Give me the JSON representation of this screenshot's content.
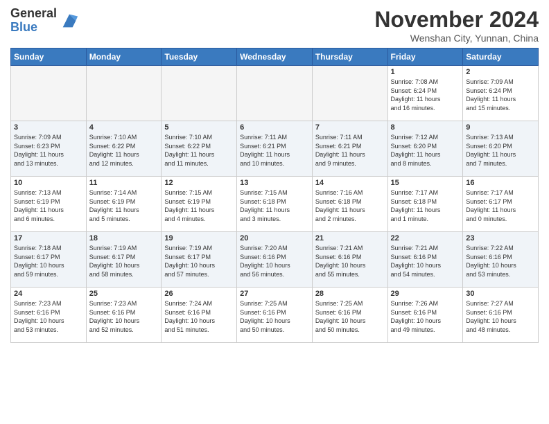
{
  "header": {
    "logo_general": "General",
    "logo_blue": "Blue",
    "month_title": "November 2024",
    "subtitle": "Wenshan City, Yunnan, China"
  },
  "days_of_week": [
    "Sunday",
    "Monday",
    "Tuesday",
    "Wednesday",
    "Thursday",
    "Friday",
    "Saturday"
  ],
  "weeks": [
    [
      {
        "day": "",
        "info": ""
      },
      {
        "day": "",
        "info": ""
      },
      {
        "day": "",
        "info": ""
      },
      {
        "day": "",
        "info": ""
      },
      {
        "day": "",
        "info": ""
      },
      {
        "day": "1",
        "info": "Sunrise: 7:08 AM\nSunset: 6:24 PM\nDaylight: 11 hours\nand 16 minutes."
      },
      {
        "day": "2",
        "info": "Sunrise: 7:09 AM\nSunset: 6:24 PM\nDaylight: 11 hours\nand 15 minutes."
      }
    ],
    [
      {
        "day": "3",
        "info": "Sunrise: 7:09 AM\nSunset: 6:23 PM\nDaylight: 11 hours\nand 13 minutes."
      },
      {
        "day": "4",
        "info": "Sunrise: 7:10 AM\nSunset: 6:22 PM\nDaylight: 11 hours\nand 12 minutes."
      },
      {
        "day": "5",
        "info": "Sunrise: 7:10 AM\nSunset: 6:22 PM\nDaylight: 11 hours\nand 11 minutes."
      },
      {
        "day": "6",
        "info": "Sunrise: 7:11 AM\nSunset: 6:21 PM\nDaylight: 11 hours\nand 10 minutes."
      },
      {
        "day": "7",
        "info": "Sunrise: 7:11 AM\nSunset: 6:21 PM\nDaylight: 11 hours\nand 9 minutes."
      },
      {
        "day": "8",
        "info": "Sunrise: 7:12 AM\nSunset: 6:20 PM\nDaylight: 11 hours\nand 8 minutes."
      },
      {
        "day": "9",
        "info": "Sunrise: 7:13 AM\nSunset: 6:20 PM\nDaylight: 11 hours\nand 7 minutes."
      }
    ],
    [
      {
        "day": "10",
        "info": "Sunrise: 7:13 AM\nSunset: 6:19 PM\nDaylight: 11 hours\nand 6 minutes."
      },
      {
        "day": "11",
        "info": "Sunrise: 7:14 AM\nSunset: 6:19 PM\nDaylight: 11 hours\nand 5 minutes."
      },
      {
        "day": "12",
        "info": "Sunrise: 7:15 AM\nSunset: 6:19 PM\nDaylight: 11 hours\nand 4 minutes."
      },
      {
        "day": "13",
        "info": "Sunrise: 7:15 AM\nSunset: 6:18 PM\nDaylight: 11 hours\nand 3 minutes."
      },
      {
        "day": "14",
        "info": "Sunrise: 7:16 AM\nSunset: 6:18 PM\nDaylight: 11 hours\nand 2 minutes."
      },
      {
        "day": "15",
        "info": "Sunrise: 7:17 AM\nSunset: 6:18 PM\nDaylight: 11 hours\nand 1 minute."
      },
      {
        "day": "16",
        "info": "Sunrise: 7:17 AM\nSunset: 6:17 PM\nDaylight: 11 hours\nand 0 minutes."
      }
    ],
    [
      {
        "day": "17",
        "info": "Sunrise: 7:18 AM\nSunset: 6:17 PM\nDaylight: 10 hours\nand 59 minutes."
      },
      {
        "day": "18",
        "info": "Sunrise: 7:19 AM\nSunset: 6:17 PM\nDaylight: 10 hours\nand 58 minutes."
      },
      {
        "day": "19",
        "info": "Sunrise: 7:19 AM\nSunset: 6:17 PM\nDaylight: 10 hours\nand 57 minutes."
      },
      {
        "day": "20",
        "info": "Sunrise: 7:20 AM\nSunset: 6:16 PM\nDaylight: 10 hours\nand 56 minutes."
      },
      {
        "day": "21",
        "info": "Sunrise: 7:21 AM\nSunset: 6:16 PM\nDaylight: 10 hours\nand 55 minutes."
      },
      {
        "day": "22",
        "info": "Sunrise: 7:21 AM\nSunset: 6:16 PM\nDaylight: 10 hours\nand 54 minutes."
      },
      {
        "day": "23",
        "info": "Sunrise: 7:22 AM\nSunset: 6:16 PM\nDaylight: 10 hours\nand 53 minutes."
      }
    ],
    [
      {
        "day": "24",
        "info": "Sunrise: 7:23 AM\nSunset: 6:16 PM\nDaylight: 10 hours\nand 53 minutes."
      },
      {
        "day": "25",
        "info": "Sunrise: 7:23 AM\nSunset: 6:16 PM\nDaylight: 10 hours\nand 52 minutes."
      },
      {
        "day": "26",
        "info": "Sunrise: 7:24 AM\nSunset: 6:16 PM\nDaylight: 10 hours\nand 51 minutes."
      },
      {
        "day": "27",
        "info": "Sunrise: 7:25 AM\nSunset: 6:16 PM\nDaylight: 10 hours\nand 50 minutes."
      },
      {
        "day": "28",
        "info": "Sunrise: 7:25 AM\nSunset: 6:16 PM\nDaylight: 10 hours\nand 50 minutes."
      },
      {
        "day": "29",
        "info": "Sunrise: 7:26 AM\nSunset: 6:16 PM\nDaylight: 10 hours\nand 49 minutes."
      },
      {
        "day": "30",
        "info": "Sunrise: 7:27 AM\nSunset: 6:16 PM\nDaylight: 10 hours\nand 48 minutes."
      }
    ]
  ]
}
